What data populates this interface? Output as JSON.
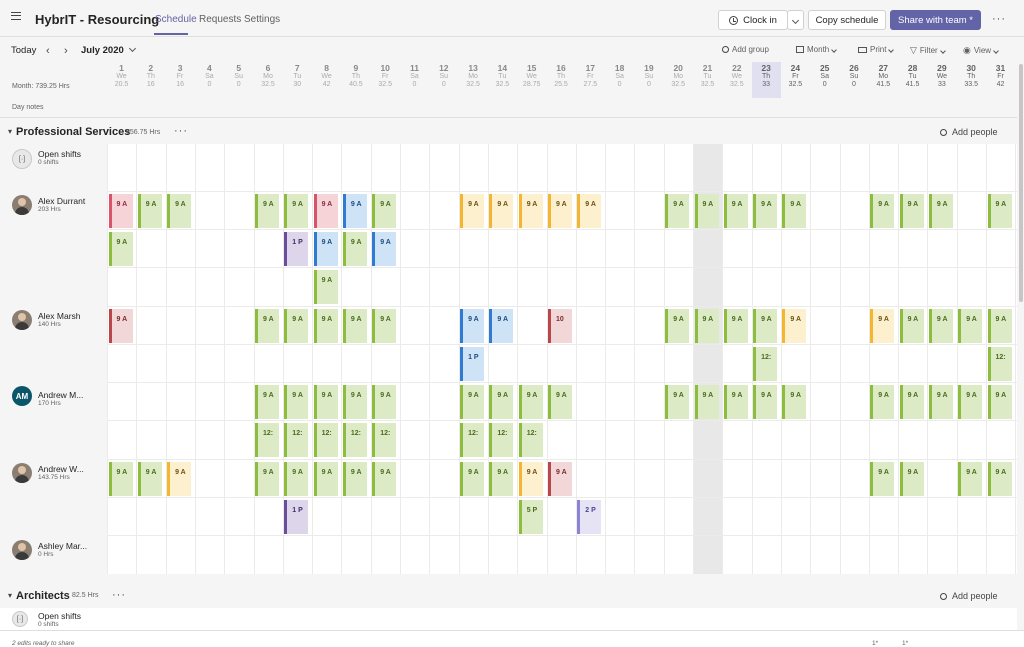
{
  "app": {
    "title": "HybrIT - Resourcing",
    "tabs": [
      {
        "label": "Schedule",
        "active": true
      },
      {
        "label": "Requests",
        "active": false
      },
      {
        "label": "Settings",
        "active": false
      }
    ],
    "clock_in_label": "Clock in",
    "copy_schedule_label": "Copy schedule",
    "share_label": "Share with team *",
    "more": "···"
  },
  "toolbar": {
    "today": "Today",
    "prev": "‹",
    "next": "›",
    "month_label": "July 2020",
    "add_group": "Add group",
    "view_period": "Month",
    "print": "Print",
    "filter": "Filter",
    "view": "View"
  },
  "calendar": {
    "month_hours": "Month: 739.25 Hrs",
    "day_notes": "Day notes",
    "days": [
      {
        "n": "1",
        "d": "We",
        "h": "20.5",
        "past": true
      },
      {
        "n": "2",
        "d": "Th",
        "h": "16",
        "past": true
      },
      {
        "n": "3",
        "d": "Fr",
        "h": "16",
        "past": true
      },
      {
        "n": "4",
        "d": "Sa",
        "h": "0",
        "past": true
      },
      {
        "n": "5",
        "d": "Su",
        "h": "0",
        "past": true
      },
      {
        "n": "6",
        "d": "Mo",
        "h": "32.5",
        "past": true
      },
      {
        "n": "7",
        "d": "Tu",
        "h": "30",
        "past": true
      },
      {
        "n": "8",
        "d": "We",
        "h": "42",
        "past": true
      },
      {
        "n": "9",
        "d": "Th",
        "h": "40.5",
        "past": true
      },
      {
        "n": "10",
        "d": "Fr",
        "h": "32.5",
        "past": true
      },
      {
        "n": "11",
        "d": "Sa",
        "h": "0",
        "past": true
      },
      {
        "n": "12",
        "d": "Su",
        "h": "0",
        "past": true
      },
      {
        "n": "13",
        "d": "Mo",
        "h": "32.5",
        "past": true
      },
      {
        "n": "14",
        "d": "Tu",
        "h": "32.5",
        "past": true
      },
      {
        "n": "15",
        "d": "We",
        "h": "28.75",
        "past": true
      },
      {
        "n": "16",
        "d": "Th",
        "h": "25.5",
        "past": true
      },
      {
        "n": "17",
        "d": "Fr",
        "h": "27.5",
        "past": true
      },
      {
        "n": "18",
        "d": "Sa",
        "h": "0",
        "past": true
      },
      {
        "n": "19",
        "d": "Su",
        "h": "0",
        "past": true
      },
      {
        "n": "20",
        "d": "Mo",
        "h": "32.5",
        "past": true
      },
      {
        "n": "21",
        "d": "Tu",
        "h": "32.5",
        "past": true
      },
      {
        "n": "22",
        "d": "We",
        "h": "32.5",
        "past": true
      },
      {
        "n": "23",
        "d": "Th",
        "h": "33",
        "today": true
      },
      {
        "n": "24",
        "d": "Fr",
        "h": "32.5"
      },
      {
        "n": "25",
        "d": "Sa",
        "h": "0"
      },
      {
        "n": "26",
        "d": "Su",
        "h": "0"
      },
      {
        "n": "27",
        "d": "Mo",
        "h": "41.5"
      },
      {
        "n": "28",
        "d": "Tu",
        "h": "41.5"
      },
      {
        "n": "29",
        "d": "We",
        "h": "33"
      },
      {
        "n": "30",
        "d": "Th",
        "h": "33.5"
      },
      {
        "n": "31",
        "d": "Fr",
        "h": "42"
      }
    ]
  },
  "groups": [
    {
      "name": "Professional Services",
      "hours": "656.75 Hrs",
      "more": "···",
      "add_people": "Add people",
      "open_shifts": {
        "title": "Open shifts",
        "sub": "0 shifts"
      },
      "members": [
        {
          "name": "Alex Durrant",
          "hours": "203 Hrs",
          "avatar": "photo"
        },
        {
          "name": "Alex Marsh",
          "hours": "140 Hrs",
          "avatar": "photo"
        },
        {
          "name": "Andrew M...",
          "hours": "170 Hrs",
          "avatar": "initials",
          "initials": "AM"
        },
        {
          "name": "Andrew W...",
          "hours": "143.75 Hrs",
          "avatar": "photo"
        },
        {
          "name": "Ashley Mar...",
          "hours": "0 Hrs",
          "avatar": "photo"
        }
      ]
    },
    {
      "name": "Architects",
      "hours": "82.5 Hrs",
      "more": "···",
      "add_people": "Add people",
      "open_shifts": {
        "title": "Open shifts",
        "sub": "0 shifts"
      }
    }
  ],
  "shifts": [
    {
      "day": 1,
      "row": 0,
      "label": "9 A",
      "color": "pink"
    },
    {
      "day": 2,
      "row": 0,
      "label": "9 A",
      "color": "green"
    },
    {
      "day": 3,
      "row": 0,
      "label": "9 A",
      "color": "green"
    },
    {
      "day": 6,
      "row": 0,
      "label": "9 A",
      "color": "green"
    },
    {
      "day": 7,
      "row": 0,
      "label": "9 A",
      "color": "green"
    },
    {
      "day": 8,
      "row": 0,
      "label": "9 A",
      "color": "pink"
    },
    {
      "day": 9,
      "row": 0,
      "label": "9 A",
      "color": "blue"
    },
    {
      "day": 10,
      "row": 0,
      "label": "9 A",
      "color": "green"
    },
    {
      "day": 13,
      "row": 0,
      "label": "9 A",
      "color": "yellow"
    },
    {
      "day": 14,
      "row": 0,
      "label": "9 A",
      "color": "yellow"
    },
    {
      "day": 15,
      "row": 0,
      "label": "9 A",
      "color": "yellow"
    },
    {
      "day": 16,
      "row": 0,
      "label": "9 A",
      "color": "yellow"
    },
    {
      "day": 17,
      "row": 0,
      "label": "9 A",
      "color": "yellow"
    },
    {
      "day": 20,
      "row": 0,
      "label": "9 A",
      "color": "green"
    },
    {
      "day": 21,
      "row": 0,
      "label": "9 A",
      "color": "green"
    },
    {
      "day": 22,
      "row": 0,
      "label": "9 A",
      "color": "green"
    },
    {
      "day": 23,
      "row": 0,
      "label": "9 A",
      "color": "green"
    },
    {
      "day": 24,
      "row": 0,
      "label": "9 A",
      "color": "green"
    },
    {
      "day": 27,
      "row": 0,
      "label": "9 A",
      "color": "green"
    },
    {
      "day": 28,
      "row": 0,
      "label": "9 A",
      "color": "green"
    },
    {
      "day": 29,
      "row": 0,
      "label": "9 A",
      "color": "green"
    },
    {
      "day": 31,
      "row": 0,
      "label": "9 A",
      "color": "green"
    },
    {
      "day": 1,
      "row": 1,
      "label": "9 A",
      "color": "green"
    },
    {
      "day": 7,
      "row": 1,
      "label": "1 P",
      "color": "purple"
    },
    {
      "day": 8,
      "row": 1,
      "label": "9 A",
      "color": "blue"
    },
    {
      "day": 9,
      "row": 1,
      "label": "9 A",
      "color": "green"
    },
    {
      "day": 10,
      "row": 1,
      "label": "9 A",
      "color": "blue"
    },
    {
      "day": 8,
      "row": 2,
      "label": "9 A",
      "color": "green"
    },
    {
      "day": 1,
      "row": 3,
      "label": "9 A",
      "color": "red"
    },
    {
      "day": 6,
      "row": 3,
      "label": "9 A",
      "color": "green"
    },
    {
      "day": 7,
      "row": 3,
      "label": "9 A",
      "color": "green"
    },
    {
      "day": 8,
      "row": 3,
      "label": "9 A",
      "color": "green"
    },
    {
      "day": 9,
      "row": 3,
      "label": "9 A",
      "color": "green"
    },
    {
      "day": 10,
      "row": 3,
      "label": "9 A",
      "color": "green"
    },
    {
      "day": 13,
      "row": 3,
      "label": "9 A",
      "color": "blue"
    },
    {
      "day": 14,
      "row": 3,
      "label": "9 A",
      "color": "blue"
    },
    {
      "day": 16,
      "row": 3,
      "label": "10",
      "color": "red"
    },
    {
      "day": 20,
      "row": 3,
      "label": "9 A",
      "color": "green"
    },
    {
      "day": 21,
      "row": 3,
      "label": "9 A",
      "color": "green"
    },
    {
      "day": 22,
      "row": 3,
      "label": "9 A",
      "color": "green"
    },
    {
      "day": 23,
      "row": 3,
      "label": "9 A",
      "color": "green"
    },
    {
      "day": 24,
      "row": 3,
      "label": "9 A",
      "color": "yellow"
    },
    {
      "day": 27,
      "row": 3,
      "label": "9 A",
      "color": "yellow"
    },
    {
      "day": 28,
      "row": 3,
      "label": "9 A",
      "color": "green"
    },
    {
      "day": 29,
      "row": 3,
      "label": "9 A",
      "color": "green"
    },
    {
      "day": 30,
      "row": 3,
      "label": "9 A",
      "color": "green"
    },
    {
      "day": 31,
      "row": 3,
      "label": "9 A",
      "color": "green"
    },
    {
      "day": 13,
      "row": 4,
      "label": "1 P",
      "color": "blue"
    },
    {
      "day": 23,
      "row": 4,
      "label": "12:",
      "color": "green"
    },
    {
      "day": 31,
      "row": 4,
      "label": "12:",
      "color": "green"
    },
    {
      "day": 6,
      "row": 5,
      "label": "9 A",
      "color": "green"
    },
    {
      "day": 7,
      "row": 5,
      "label": "9 A",
      "color": "green"
    },
    {
      "day": 8,
      "row": 5,
      "label": "9 A",
      "color": "green"
    },
    {
      "day": 9,
      "row": 5,
      "label": "9 A",
      "color": "green"
    },
    {
      "day": 10,
      "row": 5,
      "label": "9 A",
      "color": "green"
    },
    {
      "day": 13,
      "row": 5,
      "label": "9 A",
      "color": "green"
    },
    {
      "day": 14,
      "row": 5,
      "label": "9 A",
      "color": "green"
    },
    {
      "day": 15,
      "row": 5,
      "label": "9 A",
      "color": "green"
    },
    {
      "day": 16,
      "row": 5,
      "label": "9 A",
      "color": "green"
    },
    {
      "day": 20,
      "row": 5,
      "label": "9 A",
      "color": "green"
    },
    {
      "day": 21,
      "row": 5,
      "label": "9 A",
      "color": "green"
    },
    {
      "day": 22,
      "row": 5,
      "label": "9 A",
      "color": "green"
    },
    {
      "day": 23,
      "row": 5,
      "label": "9 A",
      "color": "green"
    },
    {
      "day": 24,
      "row": 5,
      "label": "9 A",
      "color": "green"
    },
    {
      "day": 27,
      "row": 5,
      "label": "9 A",
      "color": "green"
    },
    {
      "day": 28,
      "row": 5,
      "label": "9 A",
      "color": "green"
    },
    {
      "day": 29,
      "row": 5,
      "label": "9 A",
      "color": "green"
    },
    {
      "day": 30,
      "row": 5,
      "label": "9 A",
      "color": "green"
    },
    {
      "day": 31,
      "row": 5,
      "label": "9 A",
      "color": "green"
    },
    {
      "day": 6,
      "row": 6,
      "label": "12:",
      "color": "green"
    },
    {
      "day": 7,
      "row": 6,
      "label": "12:",
      "color": "green"
    },
    {
      "day": 8,
      "row": 6,
      "label": "12:",
      "color": "green"
    },
    {
      "day": 9,
      "row": 6,
      "label": "12:",
      "color": "green"
    },
    {
      "day": 10,
      "row": 6,
      "label": "12:",
      "color": "green"
    },
    {
      "day": 13,
      "row": 6,
      "label": "12:",
      "color": "green"
    },
    {
      "day": 14,
      "row": 6,
      "label": "12:",
      "color": "green"
    },
    {
      "day": 15,
      "row": 6,
      "label": "12:",
      "color": "green"
    },
    {
      "day": 1,
      "row": 7,
      "label": "9 A",
      "color": "green"
    },
    {
      "day": 2,
      "row": 7,
      "label": "9 A",
      "color": "green"
    },
    {
      "day": 3,
      "row": 7,
      "label": "9 A",
      "color": "yellow"
    },
    {
      "day": 6,
      "row": 7,
      "label": "9 A",
      "color": "green"
    },
    {
      "day": 7,
      "row": 7,
      "label": "9 A",
      "color": "green"
    },
    {
      "day": 8,
      "row": 7,
      "label": "9 A",
      "color": "green"
    },
    {
      "day": 9,
      "row": 7,
      "label": "9 A",
      "color": "green"
    },
    {
      "day": 10,
      "row": 7,
      "label": "9 A",
      "color": "green"
    },
    {
      "day": 13,
      "row": 7,
      "label": "9 A",
      "color": "green"
    },
    {
      "day": 14,
      "row": 7,
      "label": "9 A",
      "color": "green"
    },
    {
      "day": 15,
      "row": 7,
      "label": "9 A",
      "color": "yellow"
    },
    {
      "day": 16,
      "row": 7,
      "label": "9 A",
      "color": "red"
    },
    {
      "day": 27,
      "row": 7,
      "label": "9 A",
      "color": "green"
    },
    {
      "day": 28,
      "row": 7,
      "label": "9 A",
      "color": "green"
    },
    {
      "day": 30,
      "row": 7,
      "label": "9 A",
      "color": "green"
    },
    {
      "day": 31,
      "row": 7,
      "label": "9 A",
      "color": "green"
    },
    {
      "day": 7,
      "row": 8,
      "label": "1 P",
      "color": "purple"
    },
    {
      "day": 15,
      "row": 8,
      "label": "5 P",
      "color": "green"
    },
    {
      "day": 17,
      "row": 8,
      "label": "2 P",
      "color": "lavender"
    }
  ],
  "footer": {
    "edits": "2 edits ready to share",
    "markers": [
      "1*",
      "1*"
    ]
  },
  "colors": {
    "accent": "#6264a7",
    "green": "#8cbd3f",
    "yellow": "#f2b631",
    "blue": "#2f7bd1",
    "pink": "#d9546a",
    "red": "#b7474b",
    "purple": "#6b4e9a",
    "lavender": "#8b84d6"
  }
}
